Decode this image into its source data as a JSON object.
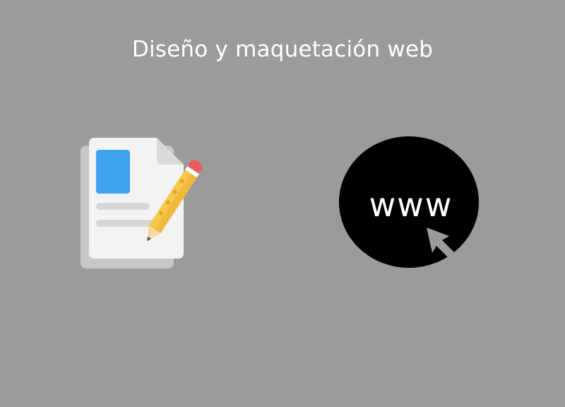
{
  "page": {
    "title": "Diseño y maquetación web"
  },
  "icons": {
    "document": "document-edit-icon",
    "web": "www-cursor-icon"
  },
  "web_badge": {
    "label": "www"
  },
  "colors": {
    "background": "#9b9b9b",
    "title_text": "#ffffff",
    "doc_blue": "#3fa2ee",
    "pencil_yellow": "#f5c74a",
    "eraser_red": "#ec5c5c",
    "globe_black": "#000000"
  }
}
